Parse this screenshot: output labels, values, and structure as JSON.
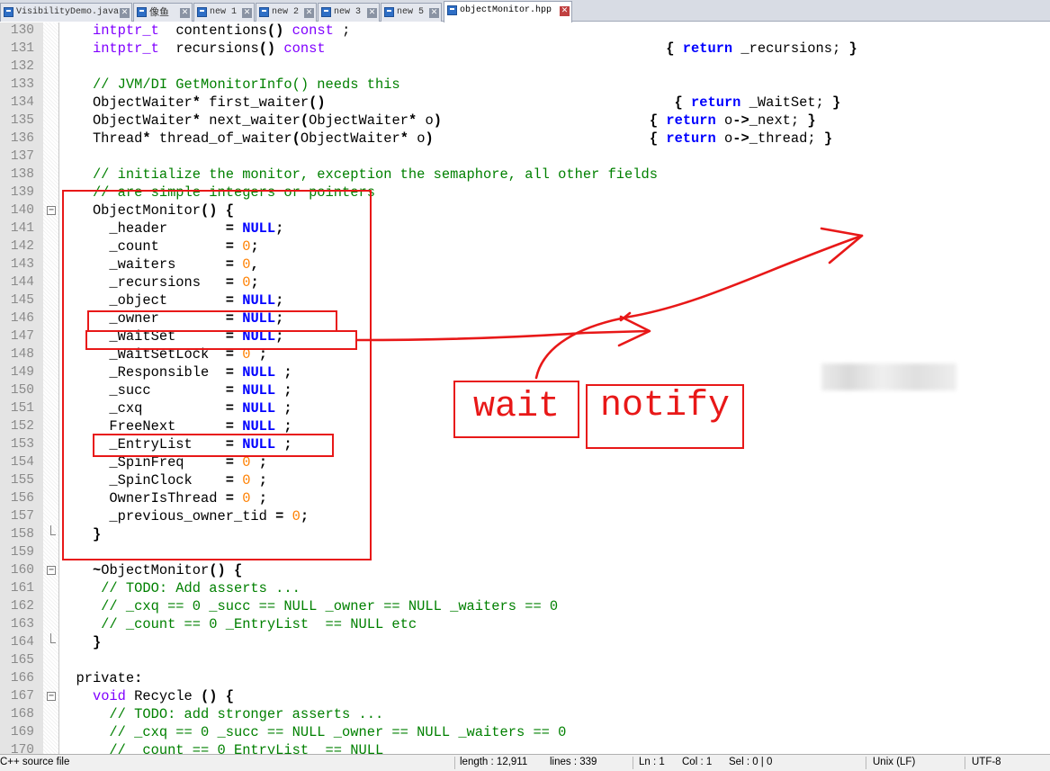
{
  "tabs": [
    {
      "label": "VisibilityDemo.java",
      "active": false
    },
    {
      "label": "像鱼",
      "active": false
    },
    {
      "label": "new 1",
      "active": false
    },
    {
      "label": "new 2",
      "active": false
    },
    {
      "label": "new 3",
      "active": false
    },
    {
      "label": "new 5",
      "active": false
    },
    {
      "label": "objectMonitor.hpp",
      "active": true
    }
  ],
  "tab_close_glyph": "✕",
  "lines": [
    {
      "n": "130",
      "fold": "",
      "t": [
        [
          "    ",
          ""
        ],
        [
          "intptr_t",
          "ty"
        ],
        [
          "  contentions",
          ""
        ],
        [
          "()",
          "b"
        ],
        [
          " const",
          "ty"
        ],
        [
          " ;",
          ""
        ]
      ]
    },
    {
      "n": "131",
      "fold": "",
      "t": [
        [
          "    ",
          ""
        ],
        [
          "intptr_t",
          "ty"
        ],
        [
          "  recursions",
          ""
        ],
        [
          "()",
          "b"
        ],
        [
          " const",
          "ty"
        ],
        [
          "                                         ",
          ""
        ],
        [
          "{ ",
          "b"
        ],
        [
          "return",
          "kw"
        ],
        [
          " _recursions; ",
          ""
        ],
        [
          "}",
          "b"
        ]
      ]
    },
    {
      "n": "132",
      "fold": "",
      "t": []
    },
    {
      "n": "133",
      "fold": "",
      "t": [
        [
          "    // JVM/DI GetMonitorInfo() needs this",
          "cm"
        ]
      ]
    },
    {
      "n": "134",
      "fold": "",
      "t": [
        [
          "    ObjectWaiter",
          ""
        ],
        [
          "*",
          "b"
        ],
        [
          " first_waiter",
          ""
        ],
        [
          "()",
          "b"
        ],
        [
          "                                          ",
          ""
        ],
        [
          "{ ",
          "b"
        ],
        [
          "return",
          "kw"
        ],
        [
          " _WaitSet; ",
          ""
        ],
        [
          "}",
          "b"
        ]
      ]
    },
    {
      "n": "135",
      "fold": "",
      "t": [
        [
          "    ObjectWaiter",
          ""
        ],
        [
          "*",
          "b"
        ],
        [
          " next_waiter",
          ""
        ],
        [
          "(",
          "b"
        ],
        [
          "ObjectWaiter",
          ""
        ],
        [
          "*",
          "b"
        ],
        [
          " o",
          ""
        ],
        [
          ")",
          "b"
        ],
        [
          "                         ",
          ""
        ],
        [
          "{ ",
          "b"
        ],
        [
          "return",
          "kw"
        ],
        [
          " o",
          ""
        ],
        [
          "->",
          "b"
        ],
        [
          "_next; ",
          ""
        ],
        [
          "}",
          "b"
        ]
      ]
    },
    {
      "n": "136",
      "fold": "",
      "t": [
        [
          "    Thread",
          ""
        ],
        [
          "*",
          "b"
        ],
        [
          " thread_of_waiter",
          ""
        ],
        [
          "(",
          "b"
        ],
        [
          "ObjectWaiter",
          ""
        ],
        [
          "*",
          "b"
        ],
        [
          " o",
          ""
        ],
        [
          ")",
          "b"
        ],
        [
          "                          ",
          ""
        ],
        [
          "{ ",
          "b"
        ],
        [
          "return",
          "kw"
        ],
        [
          " o",
          ""
        ],
        [
          "->",
          "b"
        ],
        [
          "_thread; ",
          ""
        ],
        [
          "}",
          "b"
        ]
      ]
    },
    {
      "n": "137",
      "fold": "",
      "t": []
    },
    {
      "n": "138",
      "fold": "",
      "t": [
        [
          "    // initialize the monitor, exception the semaphore, all other fields",
          "cm"
        ]
      ]
    },
    {
      "n": "139",
      "fold": "",
      "t": [
        [
          "    // are simple integers or pointers",
          "cm"
        ]
      ]
    },
    {
      "n": "140",
      "fold": "open",
      "t": [
        [
          "    ObjectMonitor",
          ""
        ],
        [
          "() {",
          "b"
        ]
      ]
    },
    {
      "n": "141",
      "fold": "",
      "t": [
        [
          "      _header       ",
          ""
        ],
        [
          "= ",
          "b"
        ],
        [
          "NULL",
          "kw"
        ],
        [
          ";",
          "b"
        ]
      ]
    },
    {
      "n": "142",
      "fold": "",
      "t": [
        [
          "      _count        ",
          ""
        ],
        [
          "= ",
          "b"
        ],
        [
          "0",
          "num"
        ],
        [
          ";",
          "b"
        ]
      ]
    },
    {
      "n": "143",
      "fold": "",
      "t": [
        [
          "      _waiters      ",
          ""
        ],
        [
          "= ",
          "b"
        ],
        [
          "0",
          "num"
        ],
        [
          ",",
          "b"
        ]
      ]
    },
    {
      "n": "144",
      "fold": "",
      "t": [
        [
          "      _recursions   ",
          ""
        ],
        [
          "= ",
          "b"
        ],
        [
          "0",
          "num"
        ],
        [
          ";",
          "b"
        ]
      ]
    },
    {
      "n": "145",
      "fold": "",
      "t": [
        [
          "      _object       ",
          ""
        ],
        [
          "= ",
          "b"
        ],
        [
          "NULL",
          "kw"
        ],
        [
          ";",
          "b"
        ]
      ]
    },
    {
      "n": "146",
      "fold": "",
      "t": [
        [
          "      _owner        ",
          ""
        ],
        [
          "= ",
          "b"
        ],
        [
          "NULL",
          "kw"
        ],
        [
          ";",
          "b"
        ]
      ]
    },
    {
      "n": "147",
      "fold": "",
      "t": [
        [
          "      _WaitSet      ",
          ""
        ],
        [
          "= ",
          "b"
        ],
        [
          "NULL",
          "kw"
        ],
        [
          ";",
          "b"
        ]
      ]
    },
    {
      "n": "148",
      "fold": "",
      "t": [
        [
          "      _WaitSetLock  ",
          ""
        ],
        [
          "= ",
          "b"
        ],
        [
          "0",
          "num"
        ],
        [
          " ;",
          "b"
        ]
      ]
    },
    {
      "n": "149",
      "fold": "",
      "t": [
        [
          "      _Responsible  ",
          ""
        ],
        [
          "= ",
          "b"
        ],
        [
          "NULL",
          "kw"
        ],
        [
          " ;",
          "b"
        ]
      ]
    },
    {
      "n": "150",
      "fold": "",
      "t": [
        [
          "      _succ         ",
          ""
        ],
        [
          "= ",
          "b"
        ],
        [
          "NULL",
          "kw"
        ],
        [
          " ;",
          "b"
        ]
      ]
    },
    {
      "n": "151",
      "fold": "",
      "t": [
        [
          "      _cxq          ",
          ""
        ],
        [
          "= ",
          "b"
        ],
        [
          "NULL",
          "kw"
        ],
        [
          " ;",
          "b"
        ]
      ]
    },
    {
      "n": "152",
      "fold": "",
      "t": [
        [
          "      FreeNext      ",
          ""
        ],
        [
          "= ",
          "b"
        ],
        [
          "NULL",
          "kw"
        ],
        [
          " ;",
          "b"
        ]
      ]
    },
    {
      "n": "153",
      "fold": "",
      "t": [
        [
          "      _EntryList    ",
          ""
        ],
        [
          "= ",
          "b"
        ],
        [
          "NULL",
          "kw"
        ],
        [
          " ;",
          "b"
        ]
      ]
    },
    {
      "n": "154",
      "fold": "",
      "t": [
        [
          "      _SpinFreq     ",
          ""
        ],
        [
          "= ",
          "b"
        ],
        [
          "0",
          "num"
        ],
        [
          " ;",
          "b"
        ]
      ]
    },
    {
      "n": "155",
      "fold": "",
      "t": [
        [
          "      _SpinClock    ",
          ""
        ],
        [
          "= ",
          "b"
        ],
        [
          "0",
          "num"
        ],
        [
          " ;",
          "b"
        ]
      ]
    },
    {
      "n": "156",
      "fold": "",
      "t": [
        [
          "      OwnerIsThread ",
          ""
        ],
        [
          "= ",
          "b"
        ],
        [
          "0",
          "num"
        ],
        [
          " ;",
          "b"
        ]
      ]
    },
    {
      "n": "157",
      "fold": "",
      "t": [
        [
          "      _previous_owner_tid ",
          ""
        ],
        [
          "= ",
          "b"
        ],
        [
          "0",
          "num"
        ],
        [
          ";",
          "b"
        ]
      ]
    },
    {
      "n": "158",
      "fold": "end",
      "t": [
        [
          "    ",
          ""
        ],
        [
          "}",
          "b"
        ]
      ]
    },
    {
      "n": "159",
      "fold": "",
      "t": []
    },
    {
      "n": "160",
      "fold": "open",
      "t": [
        [
          "    ",
          ""
        ],
        [
          "~",
          "b"
        ],
        [
          "ObjectMonitor",
          ""
        ],
        [
          "() {",
          "b"
        ]
      ]
    },
    {
      "n": "161",
      "fold": "",
      "t": [
        [
          "     // TODO: Add asserts ...",
          "cm"
        ]
      ]
    },
    {
      "n": "162",
      "fold": "",
      "t": [
        [
          "     // _cxq == 0 _succ == NULL _owner == NULL _waiters == 0",
          "cm"
        ]
      ]
    },
    {
      "n": "163",
      "fold": "",
      "t": [
        [
          "     // _count == 0 _EntryList  == NULL etc",
          "cm"
        ]
      ]
    },
    {
      "n": "164",
      "fold": "end",
      "t": [
        [
          "    ",
          ""
        ],
        [
          "}",
          "b"
        ]
      ]
    },
    {
      "n": "165",
      "fold": "",
      "t": []
    },
    {
      "n": "166",
      "fold": "",
      "t": [
        [
          "  private",
          ""
        ],
        [
          ":",
          "b"
        ]
      ]
    },
    {
      "n": "167",
      "fold": "open",
      "t": [
        [
          "    ",
          ""
        ],
        [
          "void",
          "ty"
        ],
        [
          " Recycle ",
          ""
        ],
        [
          "() {",
          "b"
        ]
      ]
    },
    {
      "n": "168",
      "fold": "",
      "t": [
        [
          "      // TODO: add stronger asserts ...",
          "cm"
        ]
      ]
    },
    {
      "n": "169",
      "fold": "",
      "t": [
        [
          "      // _cxq == 0 _succ == NULL _owner == NULL _waiters == 0",
          "cm"
        ]
      ]
    },
    {
      "n": "170",
      "fold": "",
      "t": [
        [
          "      // _count == 0 EntryList  == NULL",
          "cm"
        ]
      ]
    }
  ],
  "annotations": {
    "wait_label": "wait",
    "notify_label": "notify",
    "color": "#e81818"
  },
  "status": {
    "file_type": "C++ source file",
    "length": "length : 12,911",
    "lines": "lines : 339",
    "ln": "Ln : 1",
    "col": "Col : 1",
    "sel": "Sel : 0 | 0",
    "eol": "Unix (LF)",
    "encoding": "UTF-8"
  },
  "colors": {
    "keyword": "#0000ff",
    "type": "#8000ff",
    "comment": "#008000",
    "number": "#ff8000",
    "annotation": "#e81818"
  },
  "icons": [
    "file-icon",
    "close-icon",
    "fold-icon"
  ]
}
